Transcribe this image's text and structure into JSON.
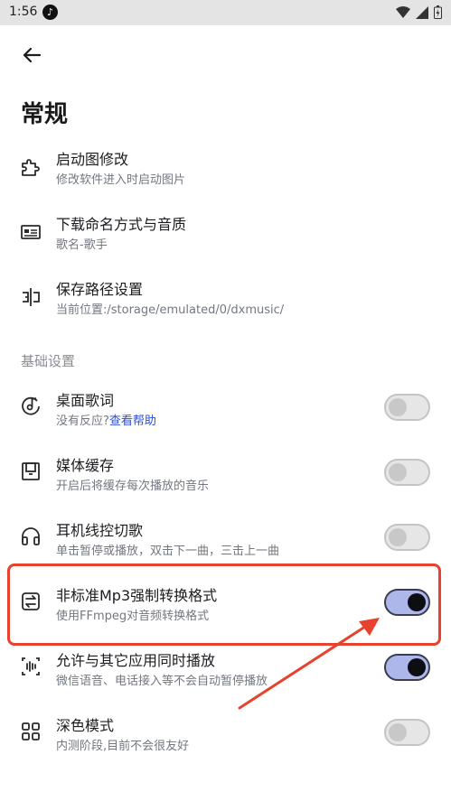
{
  "status_bar": {
    "time": "1:56",
    "music_badge": "♪"
  },
  "header": {
    "title": "常规"
  },
  "general": [
    {
      "title": "启动图修改",
      "subtitle": "修改软件进入时启动图片",
      "icon": "puzzle-icon"
    },
    {
      "title": "下载命名方式与音质",
      "subtitle": "歌名-歌手",
      "icon": "id-card-icon"
    },
    {
      "title": "保存路径设置",
      "subtitle": "当前位置:/storage/emulated/0/dxmusic/",
      "icon": "split-path-icon"
    }
  ],
  "section_basic": {
    "label": "基础设置"
  },
  "basic": [
    {
      "title": "桌面歌词",
      "subtitle": "没有反应?",
      "subtitle_link": "查看帮助",
      "icon": "record-note-icon",
      "enabled": false
    },
    {
      "title": "媒体缓存",
      "subtitle": "开启后将缓存每次播放的音乐",
      "icon": "save-icon",
      "enabled": false
    },
    {
      "title": "耳机线控切歌",
      "subtitle": "单击暂停或播放，双击下一曲，三击上一曲",
      "icon": "headphones-icon",
      "enabled": false
    },
    {
      "title": "非标准Mp3强制转换格式",
      "subtitle": "使用FFmpeg对音频转换格式",
      "icon": "convert-icon",
      "enabled": true
    },
    {
      "title": "允许与其它应用同时播放",
      "subtitle": "微信语音、电话接入等不会自动暂停播放",
      "icon": "waveform-icon",
      "enabled": true
    },
    {
      "title": "深色模式",
      "subtitle": "内测阶段,目前不会很友好",
      "icon": "grid-icon",
      "enabled": false
    }
  ],
  "colors": {
    "accent": "#aeb7ea",
    "highlight": "#e8412d",
    "link": "#2b4cd8"
  }
}
